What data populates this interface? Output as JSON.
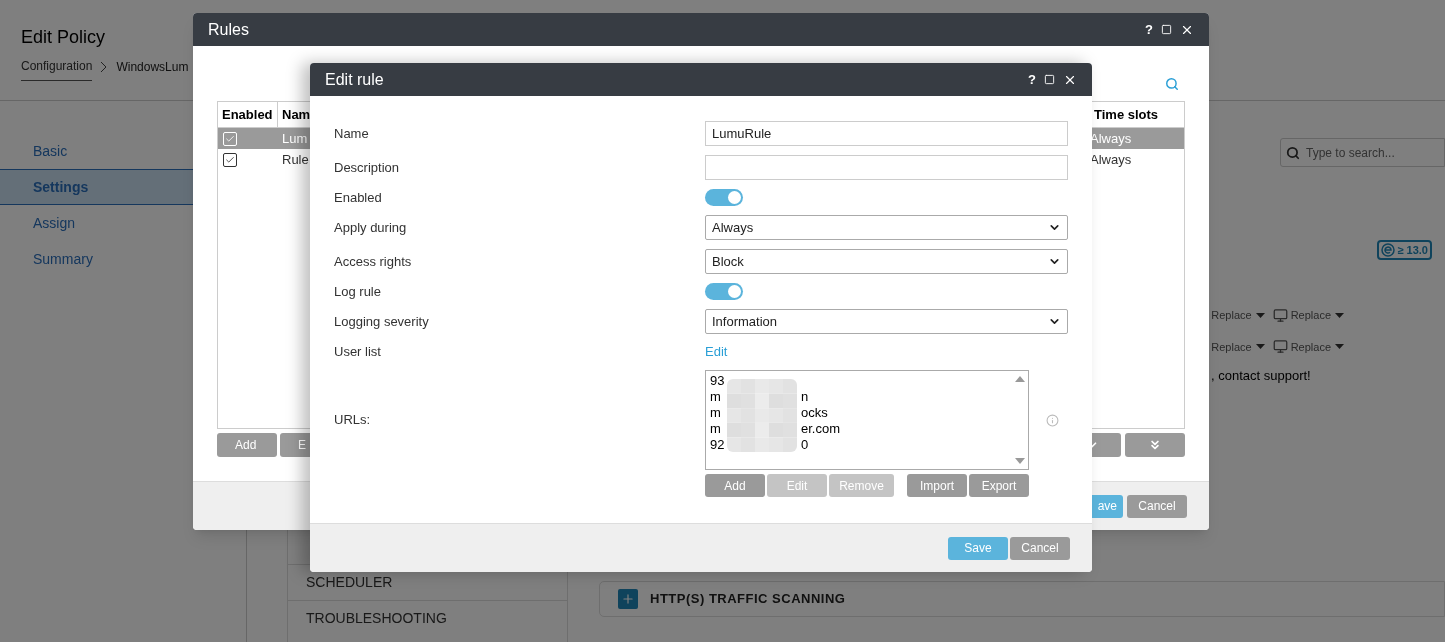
{
  "page": {
    "title": "Edit Policy",
    "breadcrumb": [
      "Configuration",
      "WindowsLum"
    ],
    "nav": [
      {
        "label": "Basic",
        "selected": false
      },
      {
        "label": "Settings",
        "selected": true
      },
      {
        "label": "Assign",
        "selected": false
      },
      {
        "label": "Summary",
        "selected": false
      }
    ],
    "sections": [
      {
        "label": "SCHEDULER"
      },
      {
        "label": "TROUBLESHOOTING"
      }
    ],
    "search": {
      "placeholder": "Type to search..."
    },
    "version_badge": "≥ 13.0",
    "replace_rows": [
      [
        "Replace",
        "Replace"
      ],
      [
        "Replace",
        "Replace"
      ]
    ],
    "support_text": ", contact support!",
    "panel": {
      "title": "HTTP(S) TRAFFIC SCANNING",
      "expanded": false
    }
  },
  "rules_dialog": {
    "title": "Rules",
    "help": "?",
    "columns": [
      "Enabled",
      "Nam",
      "Time slots"
    ],
    "rows": [
      {
        "enabled": true,
        "name": "Lum",
        "time_slots": "Always",
        "selected": true
      },
      {
        "enabled": true,
        "name": "Rule",
        "time_slots": "Always",
        "selected": false
      }
    ],
    "buttons": [
      "Add",
      "E"
    ],
    "footer": [
      {
        "label": "ave",
        "primary": true
      },
      {
        "label": "Cancel",
        "primary": false
      }
    ]
  },
  "edit_rule": {
    "title": "Edit rule",
    "help": "?",
    "fields": [
      {
        "kind": "text",
        "label": "Name",
        "value": "LumuRule"
      },
      {
        "kind": "text",
        "label": "Description"
      },
      {
        "kind": "toggle",
        "label": "Enabled",
        "on": true
      },
      {
        "kind": "select",
        "label": "Apply during",
        "value": "Always"
      },
      {
        "kind": "select",
        "label": "Access rights",
        "value": "Block"
      },
      {
        "kind": "toggle",
        "label": "Log rule",
        "on": true
      },
      {
        "kind": "select",
        "label": "Logging severity",
        "value": "Information"
      },
      {
        "kind": "link",
        "label": "User list",
        "value": "Edit"
      }
    ],
    "urls": {
      "label": "URLs:",
      "lines": [
        {
          "start": "93"
        },
        {
          "start": "m",
          "end": "n"
        },
        {
          "start": "m",
          "end": "ocks"
        },
        {
          "start": "m",
          "end": "er.com"
        },
        {
          "start": "92",
          "end": "0"
        }
      ],
      "buttons": [
        {
          "label": "Add",
          "disabled": false
        },
        {
          "label": "Edit",
          "disabled": true
        },
        {
          "label": "Remove",
          "disabled": true
        },
        {
          "label": "Import",
          "disabled": false
        },
        {
          "label": "Export",
          "disabled": false
        }
      ]
    },
    "footer": [
      {
        "label": "Save",
        "primary": true
      },
      {
        "label": "Cancel",
        "primary": false
      }
    ]
  }
}
